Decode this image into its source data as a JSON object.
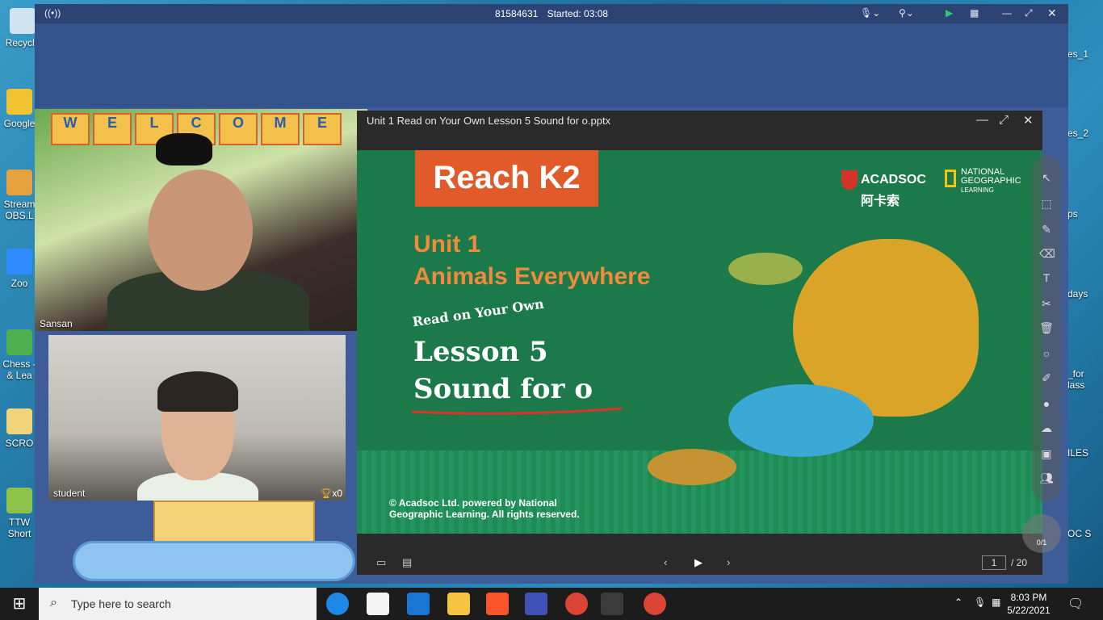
{
  "desktop": {
    "left_icons": [
      "Recycle",
      "Google",
      "Stream OBS.L",
      "Zoo",
      "Chess - & Lea",
      "SCRO",
      "TTW Short"
    ],
    "right_labels": [
      "es_1",
      "es_2",
      "ps",
      "days",
      "_for lass",
      "ILES",
      "OC S"
    ]
  },
  "meeting_bar": {
    "meeting_id": "81584631",
    "started": "Started: 03:08"
  },
  "teacher": {
    "name": "Sansan",
    "banner_letters": [
      "W",
      "E",
      "L",
      "C",
      "O",
      "M",
      "E"
    ]
  },
  "student": {
    "name": "student",
    "trophy_count": "x0"
  },
  "slide_window": {
    "title": "Unit 1 Read on Your Own Lesson 5 Sound for o.pptx",
    "slide": {
      "reach": "Reach K2",
      "unit": "Unit 1",
      "unit_title": "Animals Everywhere",
      "read_on_own": "Read on Your Own",
      "lesson": "Lesson 5",
      "sound": "Sound for o",
      "copyright_1": "© Acadsoc Ltd. powered by National",
      "copyright_2": "Geographic Learning. All rights reserved.",
      "brand_acadsoc": "ACADSOC",
      "brand_acadsoc_cn": "阿卡索",
      "brand_natgeo_1": "NATIONAL",
      "brand_natgeo_2": "GEOGRAPHIC",
      "brand_natgeo_3": "LEARNING"
    },
    "page_current": "1",
    "page_total": "/ 20"
  },
  "toolbar_fab": "0/1",
  "taskbar": {
    "search_placeholder": "Type here to search",
    "time": "8:03 PM",
    "date": "5/22/2021"
  }
}
